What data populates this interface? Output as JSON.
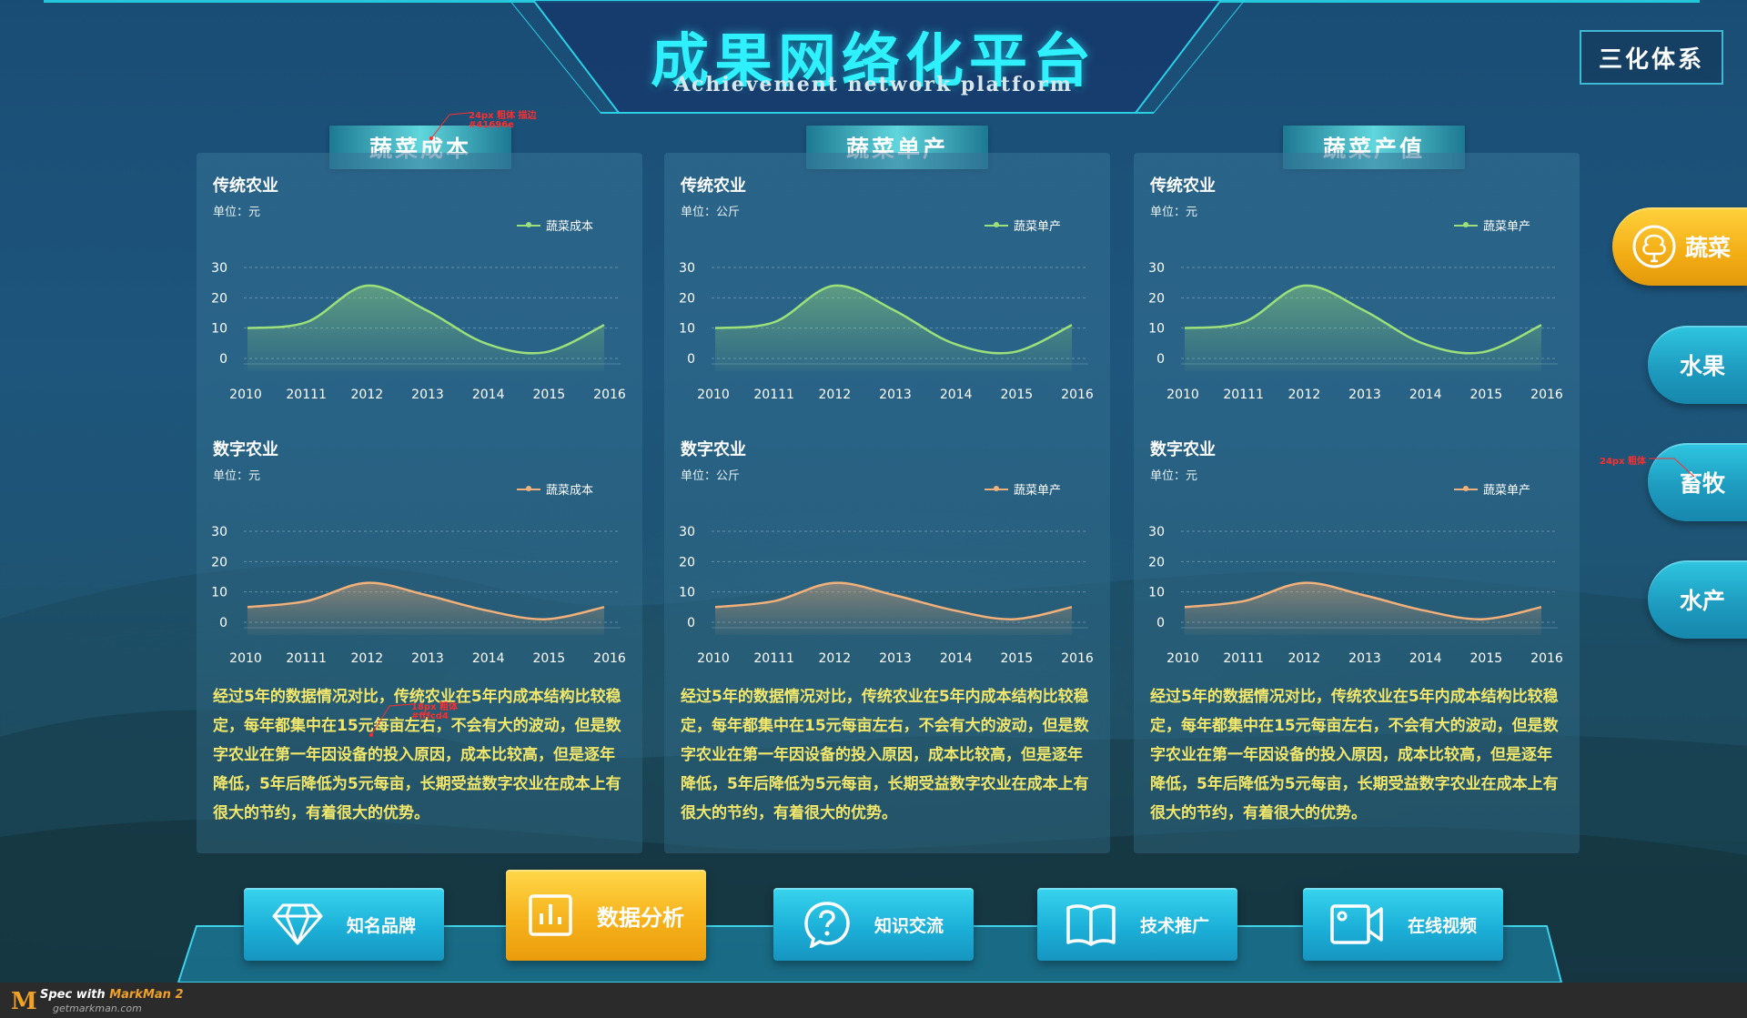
{
  "header": {
    "title": "成果网络化平台",
    "subtitle": "Achievement network platform",
    "system_button": "三化体系"
  },
  "colors": {
    "title": "#2ff0ff",
    "traditional_line": "#9be07a",
    "digital_line": "#f2b07a",
    "description_text": "#f2e76a",
    "active_button": "#f6b21b",
    "button": "#1cb0d8"
  },
  "panels": [
    {
      "tab": "蔬菜成本",
      "traditional": {
        "title": "传统农业",
        "unit": "单位：元",
        "legend": "蔬菜成本"
      },
      "digital": {
        "title": "数字农业",
        "unit": "单位：元",
        "legend": "蔬菜成本"
      },
      "description": "经过5年的数据情况对比，传统农业在5年内成本结构比较稳定，每年都集中在15元每亩左右，不会有大的波动，但是数字农业在第一年因设备的投入原因，成本比较高，但是逐年降低，5年后降低为5元每亩，长期受益数字农业在成本上有很大的节约，有着很大的优势。"
    },
    {
      "tab": "蔬菜单产",
      "traditional": {
        "title": "传统农业",
        "unit": "单位：公斤",
        "legend": "蔬菜单产"
      },
      "digital": {
        "title": "数字农业",
        "unit": "单位：公斤",
        "legend": "蔬菜单产"
      },
      "description": "经过5年的数据情况对比，传统农业在5年内成本结构比较稳定，每年都集中在15元每亩左右，不会有大的波动，但是数字农业在第一年因设备的投入原因，成本比较高，但是逐年降低，5年后降低为5元每亩，长期受益数字农业在成本上有很大的节约，有着很大的优势。"
    },
    {
      "tab": "蔬菜产值",
      "traditional": {
        "title": "传统农业",
        "unit": "单位：元",
        "legend": "蔬菜单产"
      },
      "digital": {
        "title": "数字农业",
        "unit": "单位：元",
        "legend": "蔬菜单产"
      },
      "description": "经过5年的数据情况对比，传统农业在5年内成本结构比较稳定，每年都集中在15元每亩左右，不会有大的波动，但是数字农业在第一年因设备的投入原因，成本比较高，但是逐年降低，5年后降低为5元每亩，长期受益数字农业在成本上有很大的节约，有着很大的优势。"
    }
  ],
  "chart_data": {
    "type": "area",
    "x": [
      "2010",
      "20111",
      "2012",
      "2013",
      "2014",
      "2015",
      "2016"
    ],
    "yticks": [
      0,
      10,
      20,
      30
    ],
    "ylim": [
      -3,
      33
    ],
    "grid": true,
    "legend_position": "top-right",
    "series": [
      {
        "group": "traditional",
        "values": [
          10,
          12,
          24,
          16,
          5,
          2,
          11
        ]
      },
      {
        "group": "digital",
        "values": [
          5,
          7,
          13,
          9,
          4,
          1,
          5
        ]
      }
    ]
  },
  "side_nav": [
    {
      "label": "蔬菜",
      "icon": "vegetable-icon",
      "active": true
    },
    {
      "label": "水果",
      "active": false
    },
    {
      "label": "畜牧",
      "active": false
    },
    {
      "label": "水产",
      "active": false
    }
  ],
  "bottom_nav": [
    {
      "label": "知名品牌",
      "icon": "diamond-icon",
      "active": false
    },
    {
      "label": "数据分析",
      "icon": "bar-chart-icon",
      "active": true
    },
    {
      "label": "知识交流",
      "icon": "question-icon",
      "active": false
    },
    {
      "label": "技术推广",
      "icon": "book-icon",
      "active": false
    },
    {
      "label": "在线视频",
      "icon": "video-camera-icon",
      "active": false
    }
  ],
  "footer": {
    "spec_prefix": "Spec with ",
    "spec_brand": "MarkMan 2",
    "site": "getmarkman.com",
    "logo_letter": "M"
  },
  "annotations": {
    "tab_font": "24px 粗体 描边",
    "tab_color": "#41696e",
    "desc_font": "18px 粗体",
    "desc_color": "#fffcd4",
    "side_font": "24px 粗体"
  }
}
